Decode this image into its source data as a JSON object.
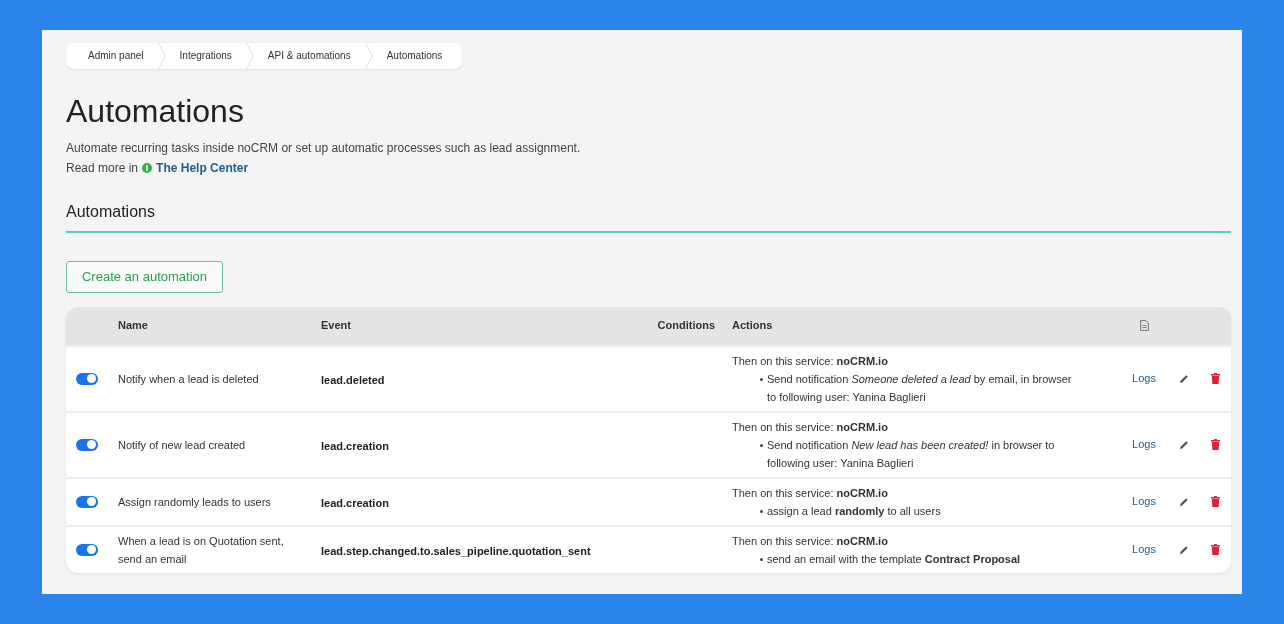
{
  "breadcrumb": [
    {
      "label": "Admin panel"
    },
    {
      "label": "Integrations"
    },
    {
      "label": "API & automations"
    },
    {
      "label": "Automations"
    }
  ],
  "header": {
    "title": "Automations",
    "description": "Automate recurring tasks inside noCRM or set up automatic processes such as lead assignment.",
    "read_more": "Read more in",
    "help_link": "The Help Center"
  },
  "section": {
    "title": "Automations",
    "create_button": "Create an automation"
  },
  "table": {
    "columns": [
      {
        "label": "Name"
      },
      {
        "label": "Event"
      },
      {
        "label": "Conditions"
      },
      {
        "label": "Actions"
      }
    ],
    "rows": [
      {
        "on": true,
        "name": "Notify when a lead is deleted",
        "event": "lead.deleted",
        "actions": {
          "intro": "Then on this service: **noCRM.io**",
          "items": [
            "Send notification *Someone deleted a lead* by email, in browser to following user: Yanina Baglieri"
          ]
        },
        "logs": "Logs"
      },
      {
        "on": true,
        "name": "Notify of new lead created",
        "event": "lead.creation",
        "actions": {
          "intro": "Then on this service: **noCRM.io**",
          "items": [
            "Send notification *New lead has been created!* in browser to following user: Yanina Baglieri"
          ]
        },
        "logs": "Logs"
      },
      {
        "on": true,
        "name": "Assign randomly leads to users",
        "event": "lead.creation",
        "actions": {
          "intro": "Then on this service: **noCRM.io**",
          "items": [
            "assign a lead **randomly** to all users"
          ]
        },
        "logs": "Logs"
      },
      {
        "on": true,
        "name": "When a lead is on Quotation sent, send an email",
        "event": "lead.step.changed.to.sales_pipeline.quotation_sent",
        "actions": {
          "intro": "Then on this service: **noCRM.io**",
          "items": [
            "send an email with the template **Contract Proposal**"
          ]
        },
        "logs": "Logs"
      }
    ]
  }
}
